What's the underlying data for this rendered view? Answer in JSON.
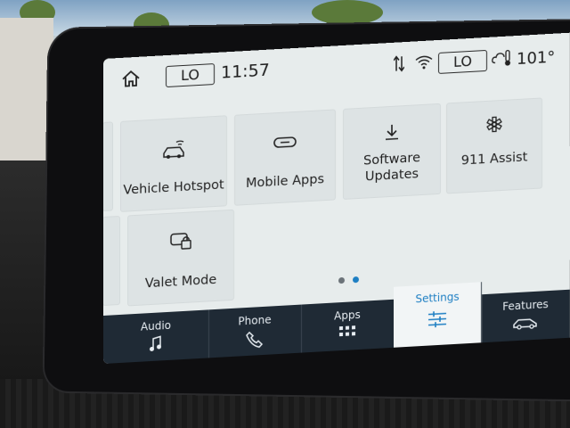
{
  "status_bar": {
    "left_climate_label": "LO",
    "time": "11:57",
    "right_climate_label": "LO",
    "temperature": "101°"
  },
  "tiles": [
    {
      "label": "Vehicle Hotspot",
      "icon": "car-wifi-icon"
    },
    {
      "label": "Mobile Apps",
      "icon": "link-icon"
    },
    {
      "label": "Software Updates",
      "icon": "download-icon"
    },
    {
      "label": "911 Assist",
      "icon": "star-of-life-icon"
    },
    {
      "label": "Valet Mode",
      "icon": "car-lock-icon"
    }
  ],
  "pager": {
    "pages": 2,
    "current": 2
  },
  "nav": {
    "tabs": [
      {
        "label": "Audio",
        "icon": "music-note-icon"
      },
      {
        "label": "Phone",
        "icon": "phone-icon"
      },
      {
        "label": "Apps",
        "icon": "apps-grid-icon"
      },
      {
        "label": "Settings",
        "icon": "sliders-icon"
      },
      {
        "label": "Features",
        "icon": "car-icon"
      }
    ],
    "active": "Settings"
  },
  "colors": {
    "accent": "#1e7fc3",
    "nav_background": "#1f2a35",
    "screen_background": "#e7ecec"
  }
}
